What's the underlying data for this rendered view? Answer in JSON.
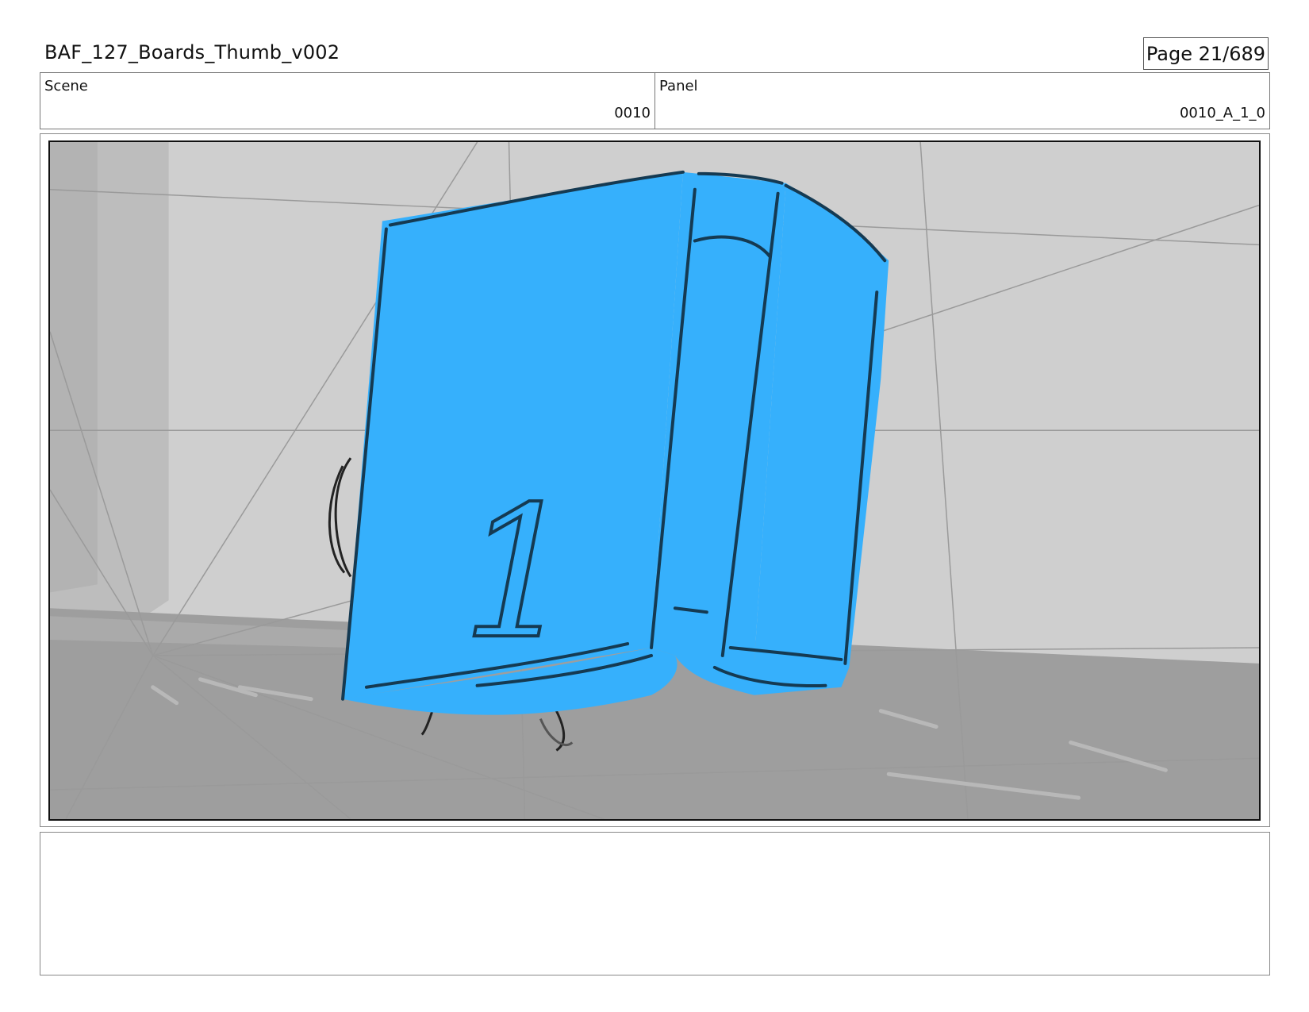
{
  "header": {
    "title": "BAF_127_Boards_Thumb_v002",
    "page": "Page  21/689"
  },
  "info": {
    "scene_label": "Scene",
    "scene_value": "0010",
    "panel_label": "Panel",
    "panel_value": "0010_A_1_0"
  },
  "panel_image": {
    "cover_numeral": "1",
    "book_color": "#36B0FC",
    "wall_color": "#CFCFCF",
    "floor_color": "#9E9E9E"
  },
  "notes": {
    "text": ""
  }
}
